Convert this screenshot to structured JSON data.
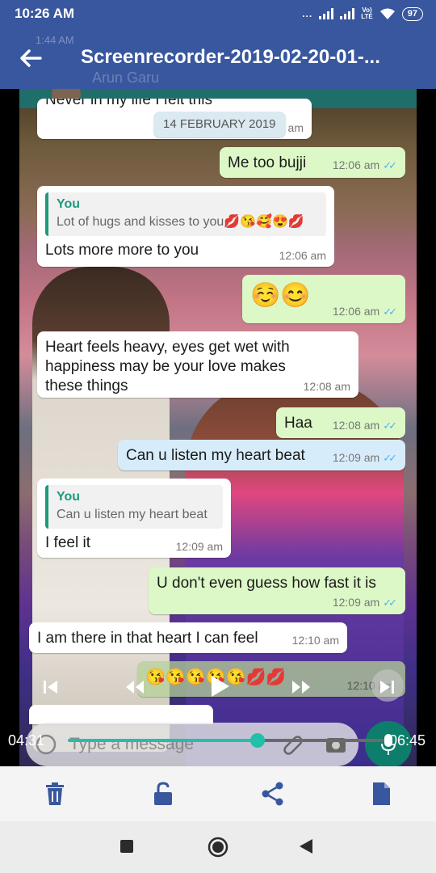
{
  "status_bar": {
    "time": "10:26 AM",
    "dots": "...",
    "volte": "Vo)\nLTE",
    "battery": "97"
  },
  "player": {
    "title": "Screenrecorder-2019-02-20-01-...",
    "current_time": "04:31",
    "total_time": "06:45",
    "progress": 0.6
  },
  "video_ghost": {
    "time": "1:44 AM",
    "contact": "Arun Garu"
  },
  "chat": {
    "date_chip": "14 FEBRUARY 2019",
    "top_partial_text": "Never in my life I felt this",
    "top_partial_time": "am",
    "messages": [
      {
        "dir": "out",
        "text": "Me too bujji",
        "time": "12:06 am",
        "ticks": "✓✓"
      },
      {
        "dir": "in",
        "quote_author": "You",
        "quote_text": "Lot of hugs and kisses to you💋😘🥰😍💋",
        "text": "Lots more more to you",
        "time": "12:06 am"
      },
      {
        "dir": "out",
        "text": "☺️😊",
        "time": "12:06 am",
        "ticks": "✓✓"
      },
      {
        "dir": "in",
        "text": "Heart feels heavy, eyes get wet with happiness may be your love makes these things",
        "time": "12:08 am"
      },
      {
        "dir": "out",
        "text": "Haa",
        "time": "12:08 am",
        "ticks": "✓✓"
      },
      {
        "dir": "out",
        "text": "Can u listen my heart beat",
        "time": "12:09 am",
        "ticks": "✓✓"
      },
      {
        "dir": "in",
        "quote_author": "You",
        "quote_text": "Can u listen my heart beat",
        "text": "I feel it",
        "time": "12:09 am"
      },
      {
        "dir": "out",
        "text": "U don't even guess how fast it is",
        "time": "12:09 am",
        "ticks": "✓✓"
      },
      {
        "dir": "in",
        "text": "I am there in that heart I can feel",
        "time": "12:10 am"
      },
      {
        "dir": "out",
        "text": "😘😘😘😘😘💋💋",
        "time": "12:10 am"
      }
    ],
    "input_placeholder": "Type a message"
  },
  "colors": {
    "header": "#38579e",
    "accent": "#22bfa9",
    "action_icon": "#38579e"
  },
  "actions": [
    "delete-icon",
    "unlock-icon",
    "share-icon",
    "file-icon"
  ],
  "nav": [
    "recents-icon",
    "home-icon",
    "back-icon"
  ]
}
